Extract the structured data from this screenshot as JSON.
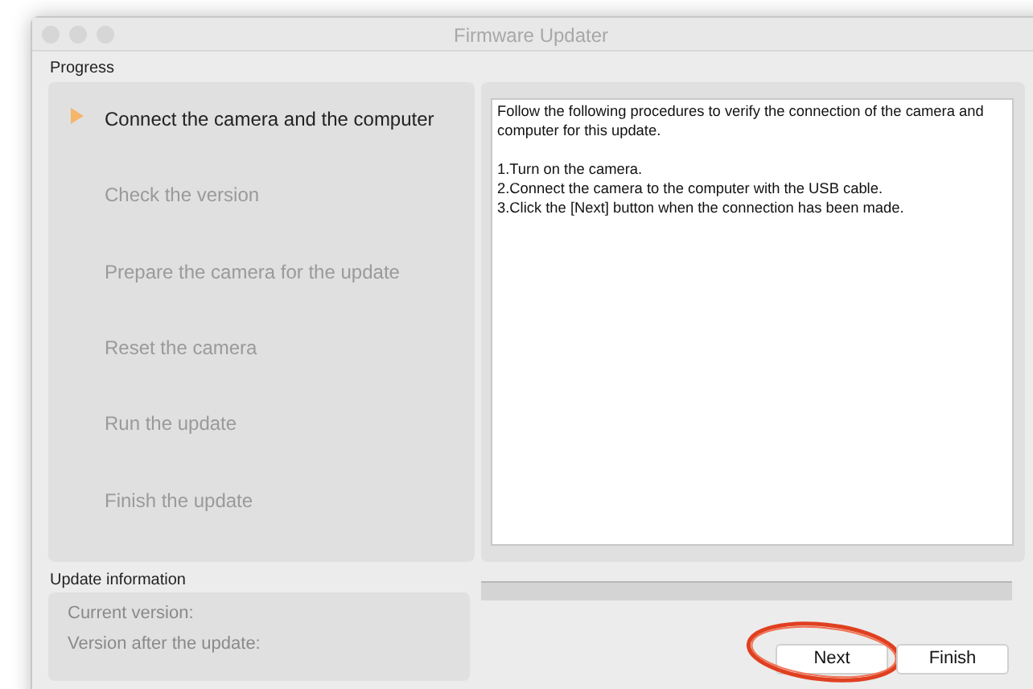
{
  "window": {
    "title": "Firmware Updater"
  },
  "progress": {
    "label": "Progress",
    "steps": [
      {
        "label": "Connect the camera and the computer",
        "selected": true
      },
      {
        "label": "Check the version",
        "selected": false
      },
      {
        "label": "Prepare the camera for the update",
        "selected": false
      },
      {
        "label": "Reset the camera",
        "selected": false
      },
      {
        "label": "Run the update",
        "selected": false
      },
      {
        "label": "Finish the update",
        "selected": false
      }
    ]
  },
  "instructions": {
    "intro": "Follow the following procedures to verify the connection of the camera and computer for this update.",
    "steps": [
      "1.Turn on the camera.",
      "2.Connect the camera to the computer with the USB cable.",
      "3.Click the [Next] button when the connection has been made."
    ]
  },
  "update_information": {
    "label": "Update information",
    "fields": [
      "Current version:",
      "Version after the update:"
    ]
  },
  "progress_bar": {
    "level": 0
  },
  "buttons": [
    {
      "label": "Next",
      "highlighted": true
    },
    {
      "label": "Finish",
      "highlighted": false
    }
  ]
}
